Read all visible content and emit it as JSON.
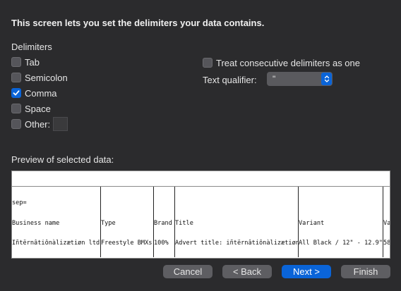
{
  "heading": "This screen lets you set the delimiters your data contains.",
  "delimiters": {
    "label": "Delimiters",
    "options": [
      {
        "label": "Tab",
        "checked": false
      },
      {
        "label": "Semicolon",
        "checked": false
      },
      {
        "label": "Comma",
        "checked": true
      },
      {
        "label": "Space",
        "checked": false
      },
      {
        "label": "Other:",
        "checked": false
      }
    ],
    "other_value": ""
  },
  "consecutive": {
    "label": "Treat consecutive delimiters as one",
    "checked": false
  },
  "text_qualifier": {
    "label": "Text qualifier:",
    "value": "\""
  },
  "preview": {
    "label": "Preview of selected data:",
    "columns": [
      {
        "lines": [
          "sep=",
          "Business name",
          "Iñtërnâtiônàlizætiøn ltd"
        ]
      },
      {
        "lines": [
          "",
          "Type",
          "Freestyle BMXs"
        ]
      },
      {
        "lines": [
          "",
          "Brand",
          "100%"
        ]
      },
      {
        "lines": [
          "",
          "Title",
          "Advert title: iñtërnâtiônàlizætiøn"
        ]
      },
      {
        "lines": [
          "",
          "Variant",
          "All Black / 12\" - 12.9\""
        ]
      },
      {
        "lines": [
          "",
          "Va",
          "58"
        ]
      }
    ]
  },
  "buttons": {
    "cancel": "Cancel",
    "back": "< Back",
    "next": "Next >",
    "finish": "Finish"
  },
  "colors": {
    "accent": "#0a64d8",
    "background": "#2b2b2d"
  }
}
